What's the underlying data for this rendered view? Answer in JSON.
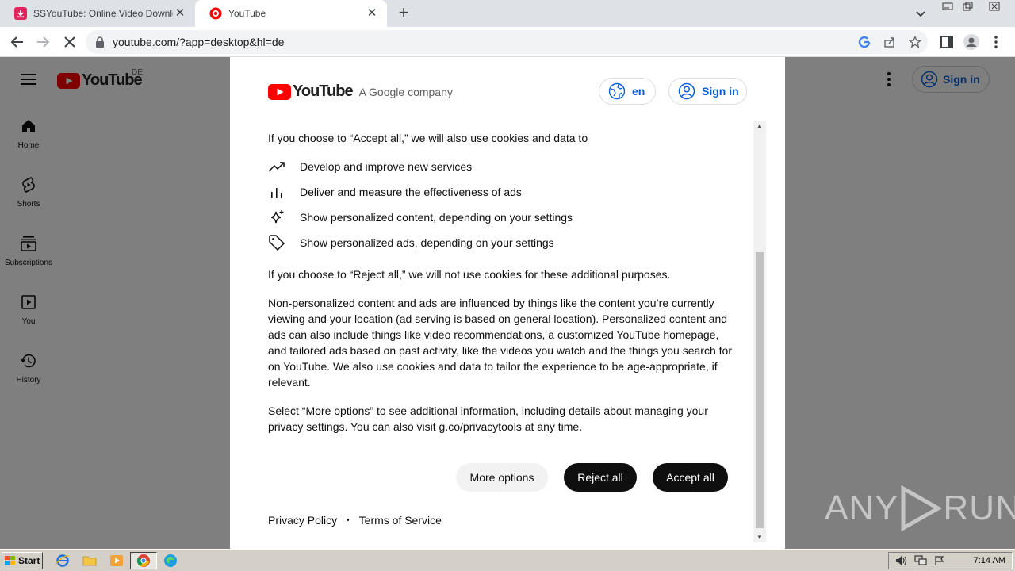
{
  "browser": {
    "tabs": [
      {
        "title": "SSYouTube: Online Video Downloade",
        "active": false
      },
      {
        "title": "YouTube",
        "active": true
      }
    ],
    "url": "youtube.com/?app=desktop&hl=de"
  },
  "youtube": {
    "logo_text": "YouTube",
    "country_code": "DE",
    "sign_in_label": "Sign in",
    "guide": [
      {
        "label": "Home",
        "icon": "home-icon"
      },
      {
        "label": "Shorts",
        "icon": "shorts-icon"
      },
      {
        "label": "Subscriptions",
        "icon": "subscriptions-icon"
      },
      {
        "label": "You",
        "icon": "you-icon"
      },
      {
        "label": "History",
        "icon": "history-icon"
      }
    ]
  },
  "consent": {
    "logo_text": "YouTube",
    "company": "A Google company",
    "language_label": "en",
    "sign_in_label": "Sign in",
    "accept_intro": "If you choose to “Accept all,” we will also use cookies and data to",
    "purposes": [
      {
        "icon": "trending-icon",
        "text": "Develop and improve new services"
      },
      {
        "icon": "bar-chart-icon",
        "text": "Deliver and measure the effectiveness of ads"
      },
      {
        "icon": "sparkle-icon",
        "text": "Show personalized content, depending on your settings"
      },
      {
        "icon": "tag-icon",
        "text": "Show personalized ads, depending on your settings"
      }
    ],
    "reject_text": "If you choose to “Reject all,” we will not use cookies for these additional purposes.",
    "nonpersonalized_text": "Non-personalized content and ads are influenced by things like the content you’re currently viewing and your location (ad serving is based on general location). Personalized content and ads can also include things like video recommendations, a customized YouTube homepage, and tailored ads based on past activity, like the videos you watch and the things you search for on YouTube. We also use cookies and data to tailor the experience to be age-appropriate, if relevant.",
    "more_options_text": "Select “More options” to see additional information, including details about managing your privacy settings. You can also visit g.co/privacytools at any time.",
    "buttons": {
      "more_options": "More options",
      "reject_all": "Reject all",
      "accept_all": "Accept all"
    },
    "footer": {
      "privacy": "Privacy Policy",
      "separator": "•",
      "terms": "Terms of Service"
    }
  },
  "watermark": {
    "left": "ANY",
    "right": "RUN"
  },
  "taskbar": {
    "start_label": "Start",
    "clock": "7:14 AM"
  }
}
